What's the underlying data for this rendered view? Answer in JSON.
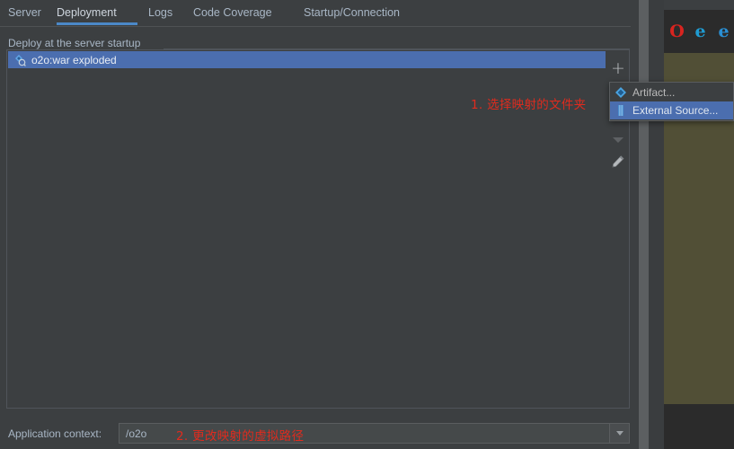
{
  "tabs": [
    {
      "label": "Server",
      "active": false
    },
    {
      "label": "Deployment",
      "active": true
    },
    {
      "label": "Logs",
      "active": false
    },
    {
      "label": "Code Coverage",
      "active": false
    },
    {
      "label": "Startup/Connection",
      "active": false
    }
  ],
  "deploy_group": {
    "title": "Deploy at the server startup",
    "rows": [
      {
        "label": "o2o:war exploded",
        "icon": "artifact-exploded-icon",
        "selected": true
      }
    ]
  },
  "toolbar": {
    "add_label": "+",
    "add_icon": "plus-icon",
    "down_icon": "chevron-down-icon",
    "edit_icon": "pencil-icon"
  },
  "popup_menu": {
    "items": [
      {
        "label": "Artifact...",
        "icon": "artifact-icon",
        "highlighted": false
      },
      {
        "label": "External Source...",
        "icon": "external-source-icon",
        "highlighted": true
      }
    ]
  },
  "annotations": [
    {
      "id": "annot-1",
      "text": "1. 选择映射的文件夹"
    },
    {
      "id": "annot-2",
      "text": "2. 更改映射的虚拟路径"
    }
  ],
  "application_context": {
    "label": "Application context:",
    "value": "/o2o",
    "dropdown_icon": "chevron-down-icon"
  },
  "browser_icons": [
    {
      "name": "opera-icon",
      "glyph": "O",
      "color": "#d8241f"
    },
    {
      "name": "internet-explorer-icon",
      "glyph": "e",
      "color": "#1f9bd1"
    },
    {
      "name": "edge-icon",
      "glyph": "e",
      "color": "#2a8fd4"
    }
  ],
  "colors": {
    "accent_blue": "#4b88c7",
    "selection_blue": "#4b6eaf",
    "annotation_red": "#e02b1e",
    "panel_bg": "#3c3f41",
    "browser_canvas": "#514f36"
  }
}
